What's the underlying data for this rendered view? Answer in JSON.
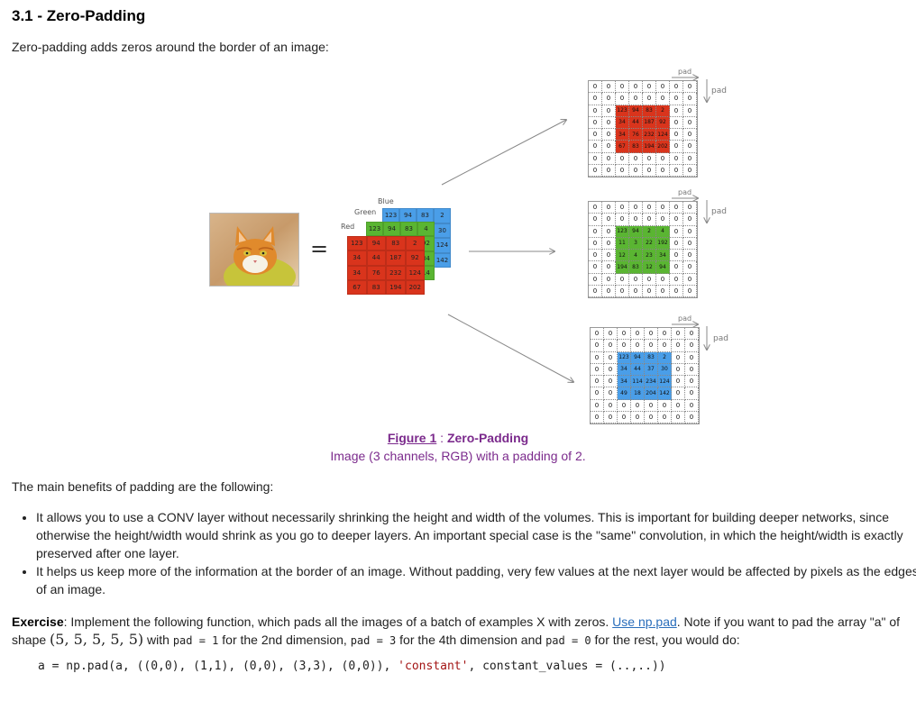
{
  "section_title": "3.1 - Zero-Padding",
  "intro_text": "Zero-padding adds zeros around the border of an image:",
  "figure": {
    "stack": {
      "blue_label": "Blue",
      "green_label": "Green",
      "red_label": "Red",
      "blue_cells": [
        [
          "123",
          "94",
          "83",
          "2"
        ],
        [
          "30"
        ],
        [
          "124"
        ],
        [
          "142"
        ]
      ],
      "green_cells": [
        [
          "123",
          "94",
          "83",
          "4"
        ],
        [
          "92"
        ],
        [
          "34"
        ],
        [
          "14"
        ]
      ],
      "red_cells": [
        [
          "123",
          "94",
          "83",
          "2"
        ],
        [
          "34",
          "44",
          "187",
          "92"
        ],
        [
          "34",
          "76",
          "232",
          "124"
        ],
        [
          "67",
          "83",
          "194",
          "202"
        ]
      ]
    },
    "pad_label": "pad",
    "padded_red": [
      [
        "0",
        "0",
        "0",
        "0",
        "0",
        "0",
        "0",
        "0"
      ],
      [
        "0",
        "0",
        "0",
        "0",
        "0",
        "0",
        "0",
        "0"
      ],
      [
        "0",
        "0",
        "123",
        "94",
        "83",
        "2",
        "0",
        "0"
      ],
      [
        "0",
        "0",
        "34",
        "44",
        "187",
        "92",
        "0",
        "0"
      ],
      [
        "0",
        "0",
        "34",
        "76",
        "232",
        "124",
        "0",
        "0"
      ],
      [
        "0",
        "0",
        "67",
        "83",
        "194",
        "202",
        "0",
        "0"
      ],
      [
        "0",
        "0",
        "0",
        "0",
        "0",
        "0",
        "0",
        "0"
      ],
      [
        "0",
        "0",
        "0",
        "0",
        "0",
        "0",
        "0",
        "0"
      ]
    ],
    "padded_green": [
      [
        "0",
        "0",
        "0",
        "0",
        "0",
        "0",
        "0",
        "0"
      ],
      [
        "0",
        "0",
        "0",
        "0",
        "0",
        "0",
        "0",
        "0"
      ],
      [
        "0",
        "0",
        "123",
        "94",
        "2",
        "4",
        "0",
        "0"
      ],
      [
        "0",
        "0",
        "11",
        "3",
        "22",
        "192",
        "0",
        "0"
      ],
      [
        "0",
        "0",
        "12",
        "4",
        "23",
        "34",
        "0",
        "0"
      ],
      [
        "0",
        "0",
        "194",
        "83",
        "12",
        "94",
        "0",
        "0"
      ],
      [
        "0",
        "0",
        "0",
        "0",
        "0",
        "0",
        "0",
        "0"
      ],
      [
        "0",
        "0",
        "0",
        "0",
        "0",
        "0",
        "0",
        "0"
      ]
    ],
    "padded_blue": [
      [
        "0",
        "0",
        "0",
        "0",
        "0",
        "0",
        "0",
        "0"
      ],
      [
        "0",
        "0",
        "0",
        "0",
        "0",
        "0",
        "0",
        "0"
      ],
      [
        "0",
        "0",
        "123",
        "94",
        "83",
        "2",
        "0",
        "0"
      ],
      [
        "0",
        "0",
        "34",
        "44",
        "37",
        "30",
        "0",
        "0"
      ],
      [
        "0",
        "0",
        "34",
        "114",
        "234",
        "124",
        "0",
        "0"
      ],
      [
        "0",
        "0",
        "49",
        "18",
        "204",
        "142",
        "0",
        "0"
      ],
      [
        "0",
        "0",
        "0",
        "0",
        "0",
        "0",
        "0",
        "0"
      ],
      [
        "0",
        "0",
        "0",
        "0",
        "0",
        "0",
        "0",
        "0"
      ]
    ],
    "colors": {
      "red": "#d9341c",
      "green": "#5ab532",
      "blue": "#4a9ee8"
    },
    "caption_link": "Figure 1",
    "caption_sep": " : ",
    "caption_title": "Zero-Padding",
    "subcaption": "Image (3 channels, RGB) with a padding of 2."
  },
  "benefits_intro": "The main benefits of padding are the following:",
  "benefits": [
    "It allows you to use a CONV layer without necessarily shrinking the height and width of the volumes. This is important for building deeper networks, since otherwise the height/width would shrink as you go to deeper layers. An important special case is the \"same\" convolution, in which the height/width is exactly preserved after one layer.",
    "It helps us keep more of the information at the border of an image. Without padding, very few values at the next layer would be affected by pixels as the edges of an image."
  ],
  "exercise": {
    "label": "Exercise",
    "text1": ": Implement the following function, which pads all the images of a batch of examples X with zeros. ",
    "link": "Use np.pad",
    "text2": ". Note if you want to pad the array \"a\" of shape ",
    "shape": "(5, 5, 5, 5, 5)",
    "text3": " with ",
    "pad1": "pad = 1",
    "text4": " for the 2nd dimension, ",
    "pad3": "pad = 3",
    "text5": " for the 4th dimension and ",
    "pad0": "pad = 0",
    "text6": " for the rest, you would do:"
  },
  "code": {
    "prefix": "a = np.pad(a, ((0,0), (1,1), (0,0), (3,3), (0,0)), ",
    "string": "'constant'",
    "suffix": ", constant_values = (..,..))"
  }
}
